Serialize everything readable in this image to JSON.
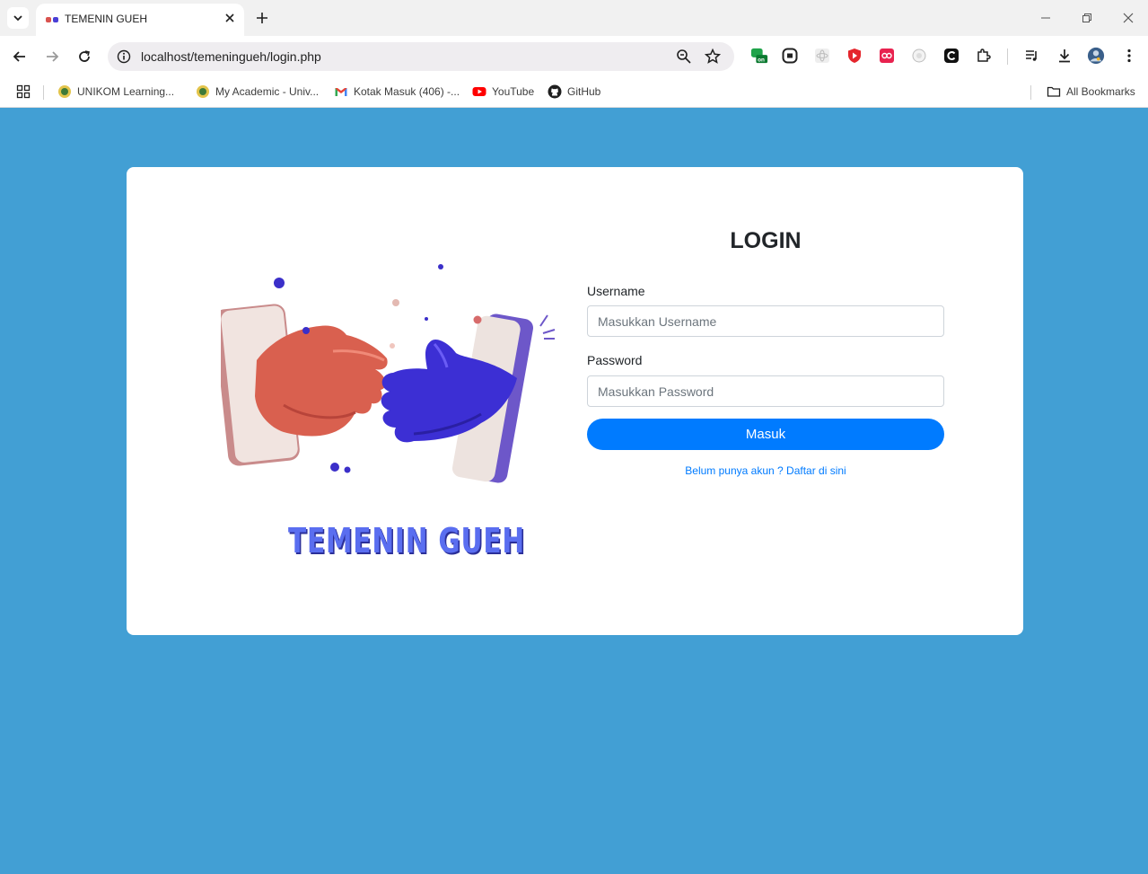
{
  "browser": {
    "tab_title": "TEMENIN GUEH",
    "url": "localhost/temeningueh/login.php",
    "bookmarks": [
      {
        "label": "UNIKOM Learning...",
        "icon": "unikom-logo-icon"
      },
      {
        "label": "My Academic - Univ...",
        "icon": "unikom-logo-icon"
      },
      {
        "label": "Kotak Masuk (406) -...",
        "icon": "gmail-icon"
      },
      {
        "label": "YouTube",
        "icon": "youtube-icon"
      },
      {
        "label": "GitHub",
        "icon": "github-icon"
      }
    ],
    "all_bookmarks": "All Bookmarks"
  },
  "page": {
    "brand": "TEMENIN GUEH",
    "title": "LOGIN",
    "username_label": "Username",
    "username_placeholder": "Masukkan Username",
    "password_label": "Password",
    "password_placeholder": "Masukkan Password",
    "submit": "Masuk",
    "register_link": "Belum punya akun ? Daftar di sini"
  },
  "colors": {
    "page_background": "#429fd4",
    "primary": "#007bff",
    "brand_text": "#5a6ef0"
  }
}
